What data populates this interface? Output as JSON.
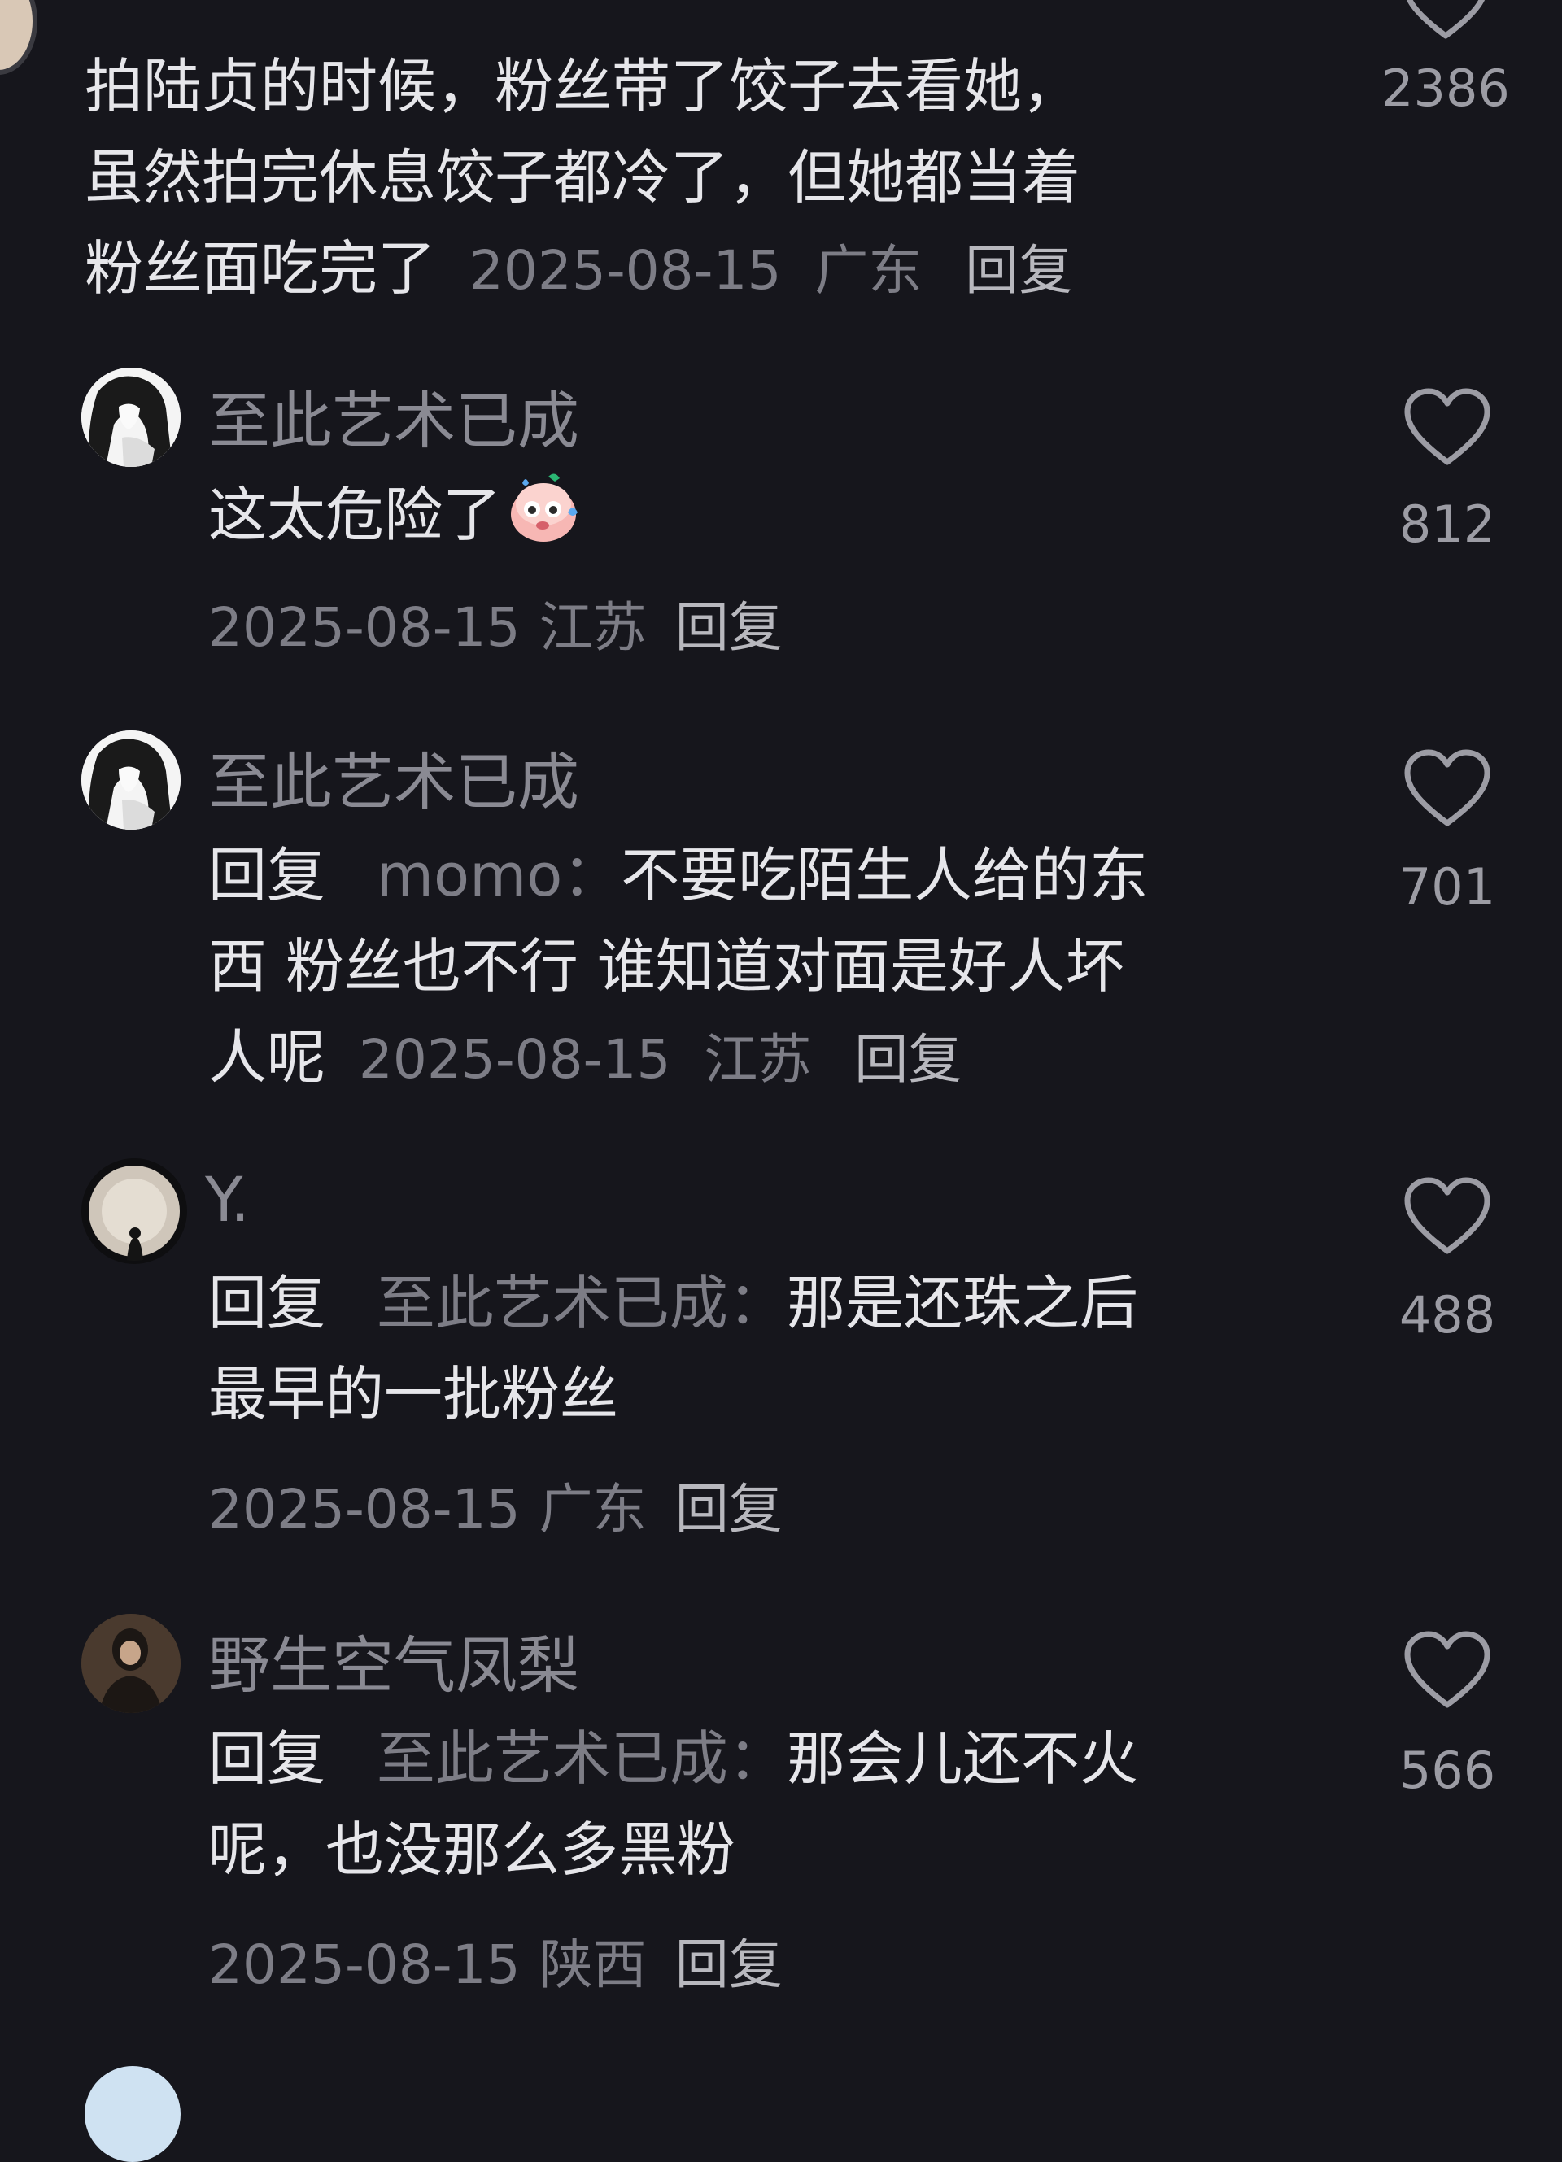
{
  "top_comment": {
    "lines": [
      "拍陆贞的时候，粉丝带了饺子去看她，",
      "虽然拍完休息饺子都冷了，但她都当着"
    ],
    "last_line": "粉丝面吃完了",
    "date": "2025-08-15",
    "location": "广东",
    "reply_label": "回复",
    "likes": "2386"
  },
  "replies": [
    {
      "username": "至此艺术已成",
      "text": "这太危险了",
      "emoji": "sweat-face-emoji",
      "date": "2025-08-15",
      "location": "江苏",
      "reply_label": "回复",
      "likes": "812"
    },
    {
      "username": "至此艺术已成",
      "reply_prefix": "回复",
      "mention": "momo",
      "colon": "：",
      "line1": "不要吃陌生人给的东",
      "line2": "西 粉丝也不行 谁知道对面是好人坏",
      "line3": "人呢",
      "date": "2025-08-15",
      "location": "江苏",
      "reply_label": "回复",
      "likes": "701"
    },
    {
      "username": "Y.",
      "reply_prefix": "回复",
      "mention": "至此艺术已成",
      "colon": "：",
      "line1": "那是还珠之后",
      "line2": "最早的一批粉丝",
      "date": "2025-08-15",
      "location": "广东",
      "reply_label": "回复",
      "likes": "488"
    },
    {
      "username": "野生空气凤梨",
      "reply_prefix": "回复",
      "mention": "至此艺术已成",
      "colon": "：",
      "line1": "那会儿还不火",
      "line2": "呢，也没那么多黑粉",
      "date": "2025-08-15",
      "location": "陕西",
      "reply_label": "回复",
      "likes": "566"
    }
  ],
  "icons": {
    "like": "heart-outline-icon"
  },
  "colors": {
    "background": "#16161c",
    "text": "#e6e6ea",
    "meta": "#7d7d86"
  }
}
